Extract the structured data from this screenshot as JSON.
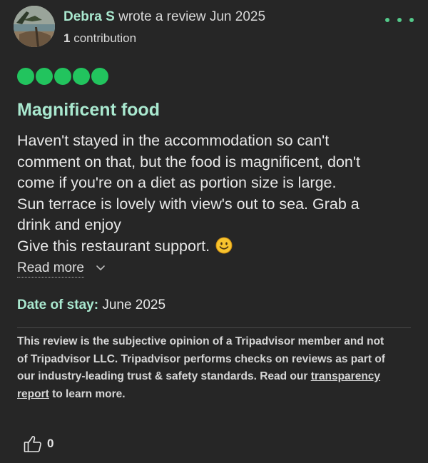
{
  "review": {
    "author": "Debra S",
    "action_text": "wrote a review Jun 2025",
    "contribution_count": "1",
    "contribution_label": "contribution",
    "rating_value": 5,
    "rating_max": 5,
    "title": "Magnificent food",
    "body_lines": [
      "Haven't stayed in the accommodation so can't",
      "comment on that, but the food is magnificent, don't",
      "come if you're on a diet as portion size is large.",
      "Sun terrace is lovely with view's out to sea. Grab a",
      "drink and enjoy",
      "Give this restaurant support."
    ],
    "read_more_label": "Read more",
    "date_of_stay_label": "Date of stay:",
    "date_of_stay_value": "June 2025",
    "helpful_count": "0"
  },
  "disclaimer": {
    "line1": "This review is the subjective opinion of a Tripadvisor member and not",
    "line2": "of Tripadvisor LLC. Tripadvisor performs checks on reviews as part of",
    "line3_pre": "our industry-leading trust & safety standards. Read our ",
    "link_part1": "transparency",
    "link_part2": "report",
    "line4_post": " to learn more."
  },
  "icons": {
    "more": "more-options-icon",
    "chevron": "chevron-down-icon",
    "emoji": "smiling-face-emoji",
    "helpful": "thumbs-up-icon"
  },
  "colors": {
    "background": "#262626",
    "accent_text": "#a9e8cf",
    "rating_bubble": "#22c45e",
    "dots": "#54c98a"
  }
}
